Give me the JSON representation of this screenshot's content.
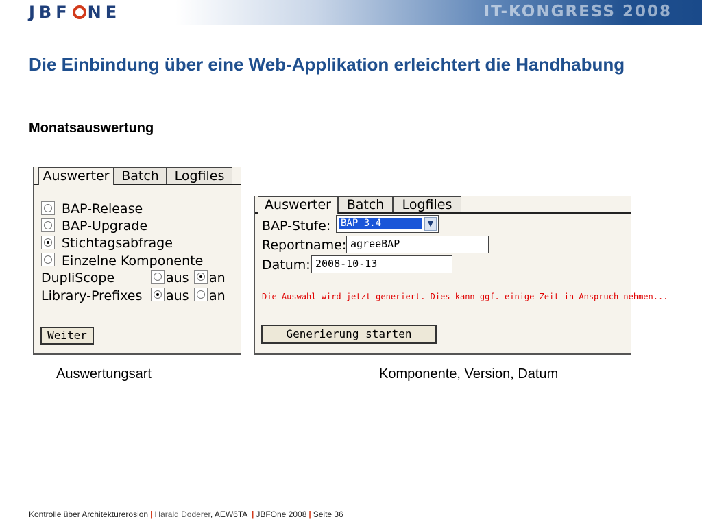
{
  "header": {
    "logo_parts": [
      "JBF",
      "NE"
    ],
    "logo_text": "JBFONE",
    "congress": "IT-KONGRESS 2008"
  },
  "slide": {
    "title": "Die Einbindung über eine Web-Applikation erleichtert die Handhabung",
    "subtitle": "Monatsauswertung"
  },
  "panel1": {
    "tabs": [
      "Auswerter",
      "Batch",
      "Logfiles"
    ],
    "options": [
      {
        "label": "BAP-Release",
        "checked": false
      },
      {
        "label": "BAP-Upgrade",
        "checked": false
      },
      {
        "label": "Stichtagsabfrage",
        "checked": true
      },
      {
        "label": "Einzelne Komponente",
        "checked": false
      }
    ],
    "toggles": [
      {
        "label": "DupliScope",
        "aus": "aus",
        "an": "an",
        "selected": "an"
      },
      {
        "label": "Library-Prefixes",
        "aus": "aus",
        "an": "an",
        "selected": "aus"
      }
    ],
    "button": "Weiter"
  },
  "panel2": {
    "tabs": [
      "Auswerter",
      "Batch",
      "Logfiles"
    ],
    "bap_stufe_label": "BAP-Stufe:",
    "bap_stufe_value": "BAP 3.4",
    "reportname_label": "Reportname:",
    "reportname_value": "agreeBAP",
    "datum_label": "Datum:",
    "datum_value": "2008-10-13",
    "message": "Die Auswahl wird jetzt generiert. Dies kann ggf. einige Zeit in Anspruch nehmen...",
    "button": "Generierung starten"
  },
  "captions": {
    "left": "Auswertungsart",
    "right": "Komponente, Version, Datum"
  },
  "footer": {
    "part1": "Kontrolle über Architekturerosion",
    "part2": "Harald Doderer",
    "part3": ", AEW6TA",
    "part4": "JBFOne 2008",
    "part5": "Seite 36",
    "separator": "|"
  },
  "colors": {
    "title": "#1f4f8e",
    "accent": "#d23a1a",
    "message": "#e00000",
    "select_highlight": "#1a56d8"
  }
}
